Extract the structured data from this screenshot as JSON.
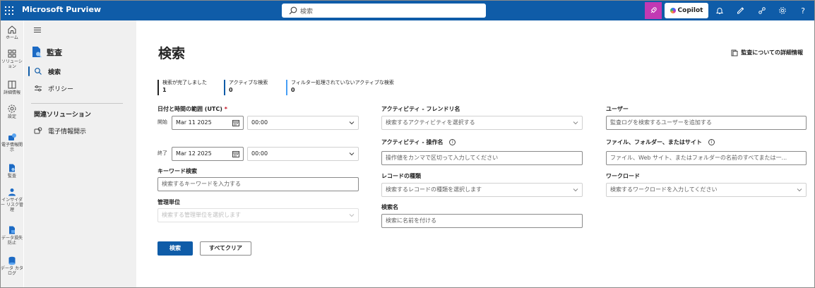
{
  "app": {
    "title": "Microsoft Purview"
  },
  "search": {
    "placeholder": "検索"
  },
  "topbar": {
    "copilot_label": "Copilot",
    "icons": [
      "pink-rocket-icon",
      "bell-icon",
      "feedback-icon",
      "connections-icon",
      "gear-icon",
      "help-icon"
    ]
  },
  "rail": {
    "items": [
      {
        "label": "ホーム",
        "icon": "home-icon"
      },
      {
        "label": "ソリューション",
        "icon": "apps-icon"
      },
      {
        "label": "詳細情報",
        "icon": "learn-icon"
      },
      {
        "label": "設定",
        "icon": "gear-icon"
      },
      {
        "label": "電子情報開示",
        "icon": "ediscovery-icon"
      },
      {
        "label": "監査",
        "icon": "audit-icon"
      },
      {
        "label": "インサイダー リスク管理",
        "icon": "insider-risk-icon"
      },
      {
        "label": "データ損失防止",
        "icon": "dlp-icon"
      },
      {
        "label": "データ カタログ",
        "icon": "data-catalog-icon"
      }
    ]
  },
  "nav": {
    "header": "監査",
    "items": [
      {
        "label": "検索",
        "icon": "search-icon",
        "active": true
      },
      {
        "label": "ポリシー",
        "icon": "policy-icon",
        "active": false
      }
    ],
    "section_title": "関連ソリューション",
    "related": [
      {
        "label": "電子情報開示",
        "icon": "ediscovery-icon"
      }
    ]
  },
  "main": {
    "title": "検索",
    "learn_more": "監査についての詳細情報",
    "stats": [
      {
        "label": "検索が完了しました",
        "value": "1",
        "color": "#242424"
      },
      {
        "label": "アクティブな検索",
        "value": "0",
        "color": "#0f5ca8"
      },
      {
        "label": "フィルター処理されていないアクティブな検索",
        "value": "0",
        "color": "#479ef5"
      }
    ],
    "date_range": {
      "label": "日付と時間の範囲 (UTC)",
      "required_mark": "*",
      "start_label": "開始",
      "start_date": "Mar 11 2025",
      "start_time": "00:00",
      "end_label": "終了",
      "end_date": "Mar 12 2025",
      "end_time": "00:00"
    },
    "keyword": {
      "label": "キーワード検索",
      "placeholder": "検索するキーワードを入力する"
    },
    "admin_units": {
      "label": "管理単位",
      "placeholder": "検索する管理単位を選択します"
    },
    "activity_friendly": {
      "label": "アクティビティ - フレンドリ名",
      "placeholder": "検索するアクティビティを選択する"
    },
    "activity_operation": {
      "label": "アクティビティ - 操作名",
      "placeholder": "操作値をカンマで区切って入力してください"
    },
    "record_type": {
      "label": "レコードの種類",
      "placeholder": "検索するレコードの種類を選択します"
    },
    "search_name": {
      "label": "検索名",
      "placeholder": "検索に名前を付ける"
    },
    "users": {
      "label": "ユーザー",
      "placeholder": "監査ログを検索するユーザーを追加する"
    },
    "files": {
      "label": "ファイル、フォルダー、またはサイト",
      "placeholder": "ファイル、Web サイト、またはフォルダーの名前のすべてまたは一..."
    },
    "workloads": {
      "label": "ワークロード",
      "placeholder": "検索するワークロードを入力してください"
    },
    "buttons": {
      "search": "検索",
      "clear": "すべてクリア"
    }
  }
}
